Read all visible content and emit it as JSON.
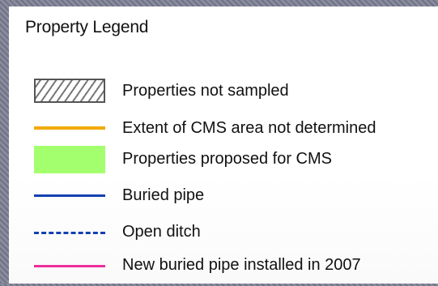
{
  "legend": {
    "title": "Property Legend",
    "items": [
      {
        "symbol": "hatched-box",
        "label": "Properties not sampled",
        "color": "#777777"
      },
      {
        "symbol": "solid-line",
        "label": "Extent of CMS area not determined",
        "color": "#f2a900"
      },
      {
        "symbol": "filled-box",
        "label": "Properties proposed for CMS",
        "color": "#a4ff6e"
      },
      {
        "symbol": "solid-line",
        "label": "Buried pipe",
        "color": "#1240b0"
      },
      {
        "symbol": "dashed-line",
        "label": "Open ditch",
        "color": "#1240b0"
      },
      {
        "symbol": "solid-line",
        "label": "New buried pipe installed in 2007",
        "color": "#ee2e9c"
      }
    ]
  }
}
